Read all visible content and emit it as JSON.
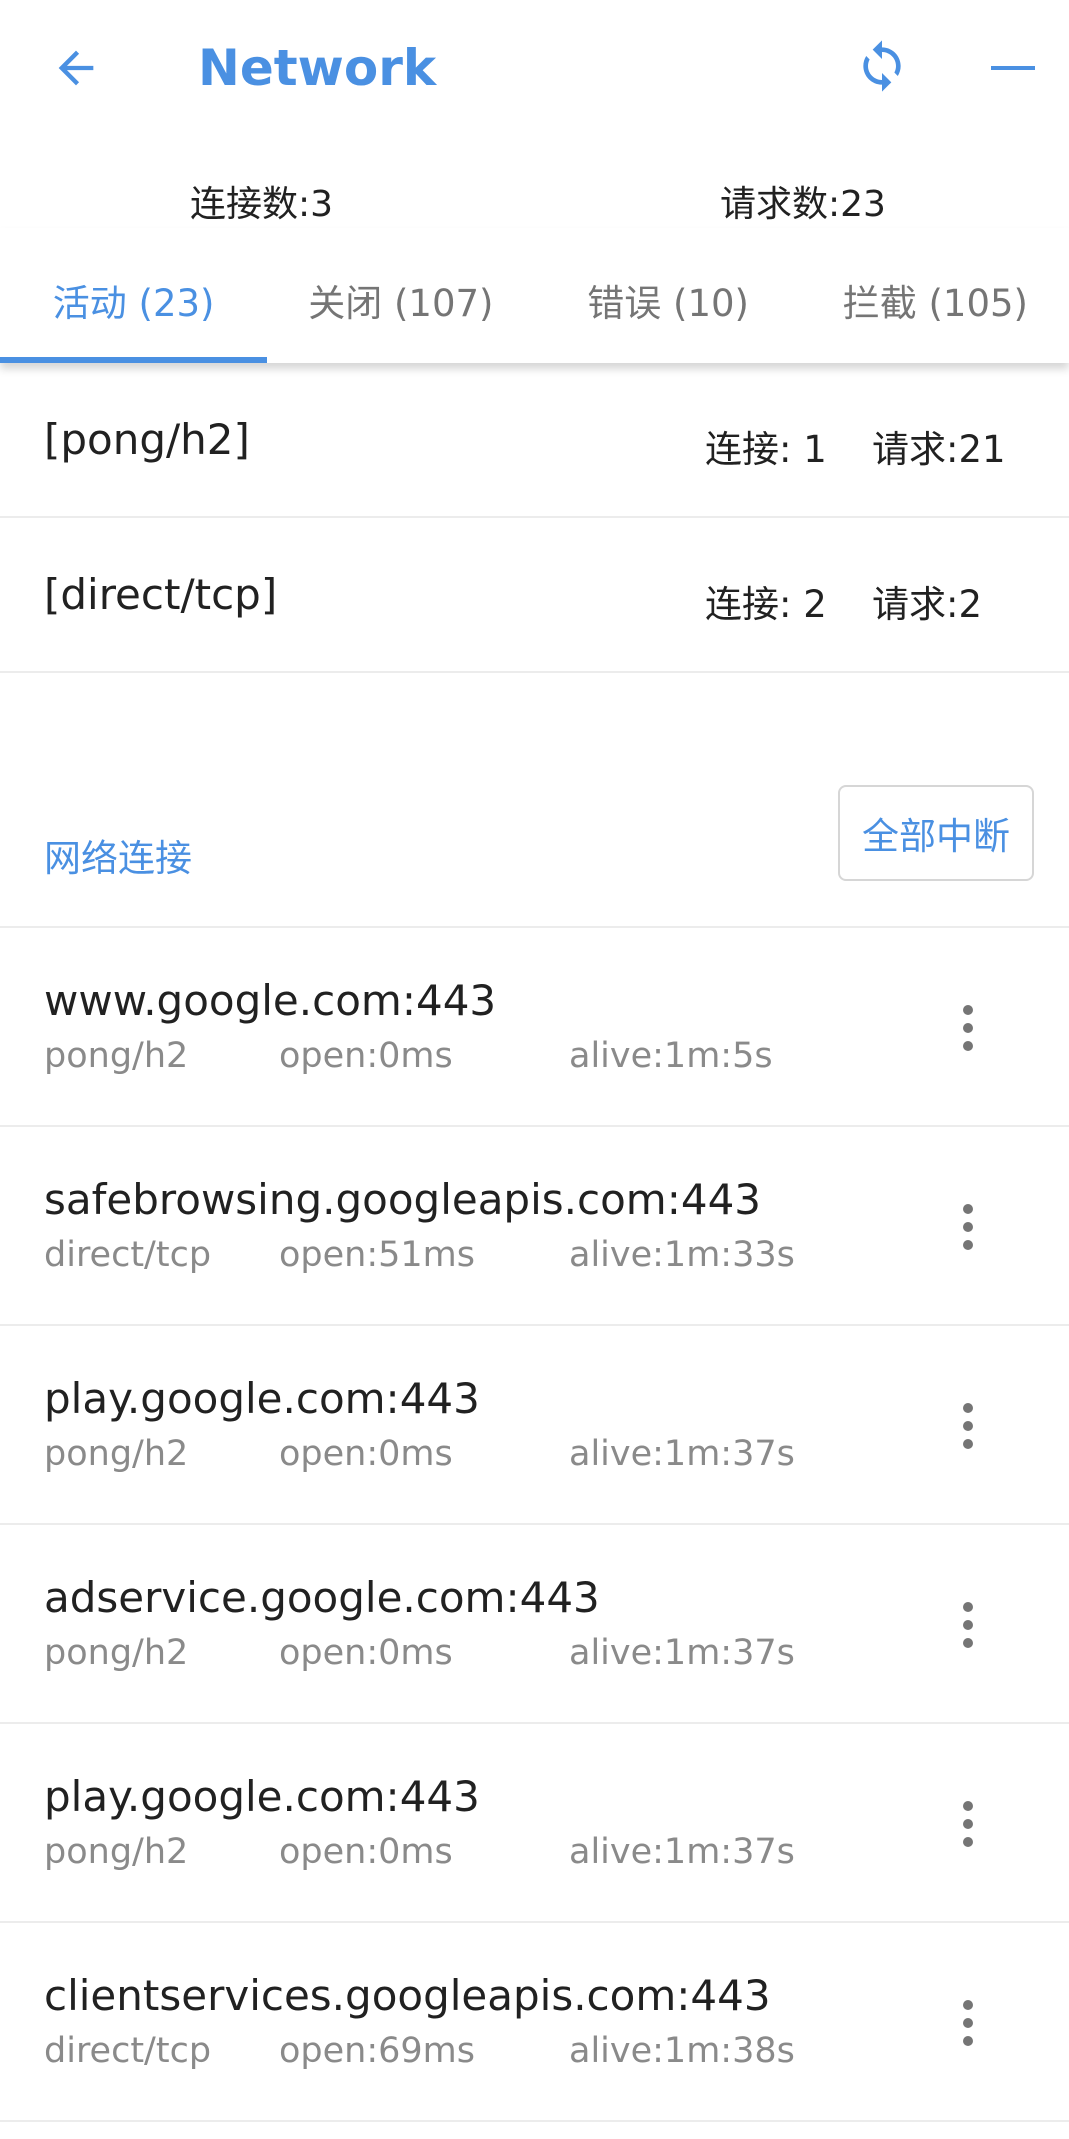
{
  "header": {
    "title": "Network",
    "back_icon": "arrow-left-icon",
    "refresh_icon": "sync-icon",
    "minimize_icon": "minus-icon",
    "accent_color": "#4a90e2"
  },
  "stats": {
    "connections": "连接数:3",
    "requests": "请求数:23"
  },
  "tabs": [
    {
      "label": "活动 (23)",
      "active": true
    },
    {
      "label": "关闭 (107)",
      "active": false
    },
    {
      "label": "错误 (10)",
      "active": false
    },
    {
      "label": "拦截 (105)",
      "active": false
    }
  ],
  "groups": [
    {
      "name": "[pong/h2]",
      "connections": "连接: 1",
      "requests": "请求:21"
    },
    {
      "name": "[direct/tcp]",
      "connections": "连接: 2",
      "requests": "请求:2"
    }
  ],
  "section": {
    "title": "网络连接",
    "stop_all_label": "全部中断"
  },
  "connections": [
    {
      "host": "www.google.com:443",
      "proto": "pong/h2",
      "open": "open:0ms",
      "alive": "alive:1m:5s"
    },
    {
      "host": "safebrowsing.googleapis.com:443",
      "proto": "direct/tcp",
      "open": "open:51ms",
      "alive": "alive:1m:33s"
    },
    {
      "host": "play.google.com:443",
      "proto": "pong/h2",
      "open": "open:0ms",
      "alive": "alive:1m:37s"
    },
    {
      "host": "adservice.google.com:443",
      "proto": "pong/h2",
      "open": "open:0ms",
      "alive": "alive:1m:37s"
    },
    {
      "host": "play.google.com:443",
      "proto": "pong/h2",
      "open": "open:0ms",
      "alive": "alive:1m:37s"
    },
    {
      "host": "clientservices.googleapis.com:443",
      "proto": "direct/tcp",
      "open": "open:69ms",
      "alive": "alive:1m:38s"
    }
  ]
}
